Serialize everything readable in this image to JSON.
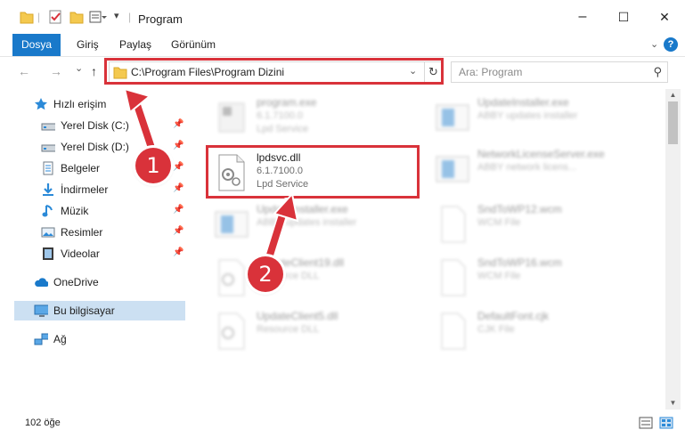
{
  "window": {
    "title": "Program",
    "minimize": "–",
    "maximize": "☐",
    "close": "✕"
  },
  "ribbon": {
    "tabs": [
      "Dosya",
      "Giriş",
      "Paylaş",
      "Görünüm"
    ],
    "help": "?"
  },
  "nav": {
    "back": "←",
    "forward": "→",
    "recent": "⌄",
    "up": "↑",
    "address": "C:\\Program Files\\Program Dizini",
    "search_placeholder": "Ara: Program"
  },
  "sidebar": {
    "items": [
      {
        "label": "Hızlı erişim",
        "icon": "star-icon"
      },
      {
        "label": "Yerel Disk (C:)",
        "icon": "drive-icon",
        "pinned": true
      },
      {
        "label": "Yerel Disk (D:)",
        "icon": "drive-icon",
        "pinned": true
      },
      {
        "label": "Belgeler",
        "icon": "documents-icon",
        "pinned": true
      },
      {
        "label": "İndirmeler",
        "icon": "download-icon",
        "pinned": true
      },
      {
        "label": "Müzik",
        "icon": "music-icon",
        "pinned": true
      },
      {
        "label": "Resimler",
        "icon": "pictures-icon",
        "pinned": true
      },
      {
        "label": "Videolar",
        "icon": "videos-icon",
        "pinned": true
      },
      {
        "label": "OneDrive",
        "icon": "cloud-icon"
      },
      {
        "label": "Bu bilgisayar",
        "icon": "computer-icon",
        "selected": true
      },
      {
        "label": "Ağ",
        "icon": "network-icon"
      }
    ]
  },
  "files": [
    {
      "name": "program.exe",
      "line1": "6.1.7100.0",
      "line2": "Lpd Service",
      "icon": "exe"
    },
    {
      "name": "UpdateInstaller.exe",
      "line1": "ABBY updates installer",
      "line2": "",
      "icon": "exe-blue"
    },
    {
      "name": "lpdsvc.dll",
      "line1": "6.1.7100.0",
      "line2": "Lpd Service",
      "icon": "dll",
      "highlighted": true
    },
    {
      "name": "NetworkLicenseServer.exe",
      "line1": "ABBY network licens...",
      "line2": "",
      "icon": "exe-blue"
    },
    {
      "name": "UpdateInstaller.exe",
      "line1": "ABBY updates installer",
      "line2": "",
      "icon": "exe-blue"
    },
    {
      "name": "SndToWP12.wcm",
      "line1": "WCM File",
      "line2": "",
      "icon": "blank"
    },
    {
      "name": "UpdateClient19.dll",
      "line1": "Resource DLL",
      "line2": "",
      "icon": "dll"
    },
    {
      "name": "SndToWP16.wcm",
      "line1": "WCM File",
      "line2": "",
      "icon": "blank"
    },
    {
      "name": "UpdateClient5.dll",
      "line1": "Resource DLL",
      "line2": "",
      "icon": "dll"
    },
    {
      "name": "DefaultFont.cjk",
      "line1": "CJK File",
      "line2": "",
      "icon": "blank"
    }
  ],
  "status": {
    "count": "102 öğe"
  },
  "annotations": {
    "step1": "1",
    "step2": "2"
  },
  "colors": {
    "accent": "#1979ca",
    "highlight": "#d9323a",
    "selected_bg": "#cce0f2"
  }
}
